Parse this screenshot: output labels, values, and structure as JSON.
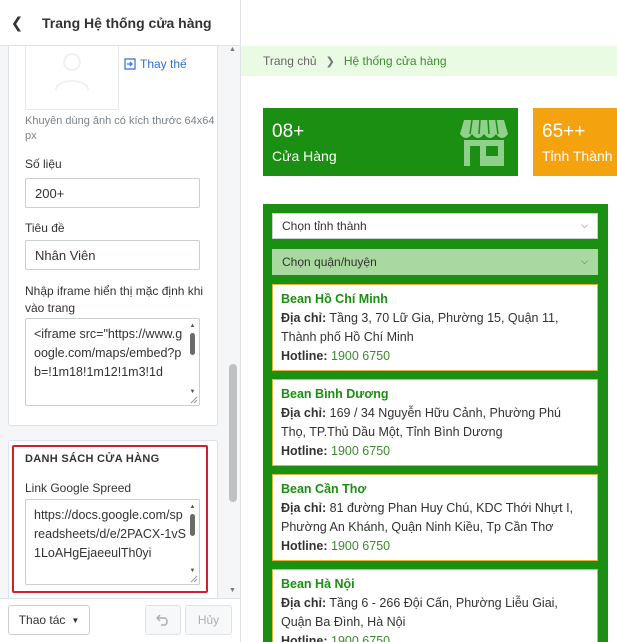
{
  "panel": {
    "title": "Trang Hệ thống cửa hàng",
    "replace_label": "Thay thế",
    "image_hint": "Khuyên dùng ảnh có kích thước 64x64 px",
    "stat_number_label": "Số liệu",
    "stat_number_value": "200+",
    "stat_title_label": "Tiêu đề",
    "stat_title_value": "Nhân Viên",
    "iframe_label": "Nhập iframe hiển thị mặc định khi vào trang",
    "iframe_value": "<iframe src=\"https://www.google.com/maps/embed?pb=!1m18!1m12!1m3!1d",
    "section_title": "DANH SÁCH CỬA HÀNG",
    "sheet_label": "Link Google Spreed",
    "sheet_value": "https://docs.google.com/spreadsheets/d/e/2PACX-1vS1LoAHgEjaeeulTh0yi",
    "footer": {
      "actions_label": "Thao tác",
      "cancel_label": "Hủy"
    }
  },
  "preview": {
    "breadcrumb": {
      "home": "Trang chủ",
      "current": "Hệ thống cửa hàng"
    },
    "stats": [
      {
        "number": "08+",
        "label": "Cửa Hàng",
        "color": "#1b8f12"
      },
      {
        "number": "65++",
        "label": "Tỉnh Thành",
        "color": "#f5a20f"
      }
    ],
    "city_select": "Chọn tỉnh thành",
    "district_select": "Chọn quận/huyện",
    "address_label": "Địa chỉ:",
    "hotline_label": "Hotline:",
    "stores": [
      {
        "name": "Bean Hồ Chí Minh",
        "address": "Tầng 3, 70 Lữ Gia, Phường 15, Quận 11, Thành phố Hồ Chí Minh",
        "hotline": "1900 6750"
      },
      {
        "name": "Bean Bình Dương",
        "address": "169 / 34 Nguyễn Hữu Cảnh, Phường Phú Thọ, TP.Thủ Dầu Một, Tỉnh Bình Dương",
        "hotline": "1900 6750"
      },
      {
        "name": "Bean Cần Thơ",
        "address": "81 đường Phan Huy Chú, KDC Thới Nhựt I, Phường An Khánh, Quận Ninh Kiều, Tp Cần Thơ",
        "hotline": "1900 6750"
      },
      {
        "name": "Bean Hà Nội",
        "address": "Tầng 6 - 266 Đội Cấn, Phường Liễu Giai, Quận Ba Đình, Hà Nội",
        "hotline": "1900 6750"
      }
    ]
  },
  "colors": {
    "brand_green": "#1b8f12",
    "accent_orange": "#f5a20f",
    "highlight_red": "#d0202a",
    "link_blue": "#2f6fd6"
  }
}
